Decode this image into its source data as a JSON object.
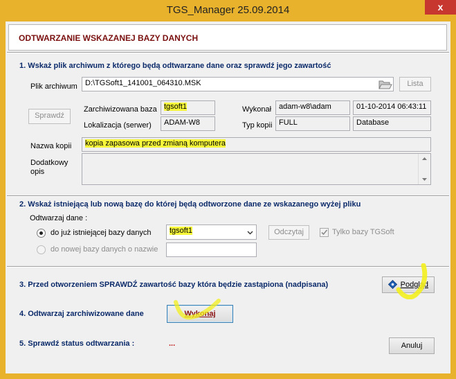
{
  "window": {
    "title": "TGS_Manager  25.09.2014",
    "close_glyph": "x"
  },
  "header": {
    "title": "ODTWARZANIE WSKAZANEJ BAZY DANYCH"
  },
  "step1": {
    "heading": "1. Wskaż plik archiwum z którego będą odtwarzane dane oraz sprawdź jego zawartość",
    "archive_label": "Plik archiwum",
    "archive_value": "D:\\TGSoft1_141001_064310.MSK",
    "list_button": "Lista",
    "check_button": "Sprawdź",
    "archived_db_label": "Zarchiwizowana baza",
    "archived_db_value": "tgsoft1",
    "location_label": "Lokalizacja (serwer)",
    "location_value": "ADAM-W8",
    "performed_label": "Wykonał",
    "performed_value": "adam-w8\\adam",
    "datetime_value": "01-10-2014 06:43:11",
    "copy_type_label": "Typ kopii",
    "copy_type_value": "FULL",
    "copy_target_value": "Database",
    "copy_name_label": "Nazwa kopii",
    "copy_name_value": "kopia zapasowa przed zmianą komputera",
    "desc_label_1": "Dodatkowy",
    "desc_label_2": "opis",
    "desc_value": ""
  },
  "step2": {
    "heading": "2. Wskaż istniejącą lub nową bazę do której będą odtworzone dane ze wskazanego wyżej pliku",
    "restore_to_label": "Odtwarzaj dane :",
    "option_existing": "do już istniejącej bazy danych",
    "existing_value": "tgsoft1",
    "read_button": "Odczytaj",
    "only_tgsoft_label": "Tylko bazy TGSoft",
    "only_tgsoft_checked": true,
    "option_new": "do nowej bazy danych o nazwie",
    "new_db_value": ""
  },
  "step3": {
    "heading": "3. Przed otworzeniem SPRAWDŹ zawartość bazy która będzie zastąpiona (nadpisana)",
    "preview_button": "Podgląd"
  },
  "step4": {
    "heading": "4. Odtwarzaj zarchiwizowane dane",
    "execute_button": "Wykonaj"
  },
  "step5": {
    "heading": "5. Sprawdź status odtwarzania :",
    "status_value": "...",
    "cancel_button": "Anuluj"
  },
  "colors": {
    "title_bar": "#e9b22c",
    "step_text": "#0b2a6a",
    "header_text": "#7a1010",
    "highlight": "#f6f63a",
    "close_red": "#c7372f"
  }
}
